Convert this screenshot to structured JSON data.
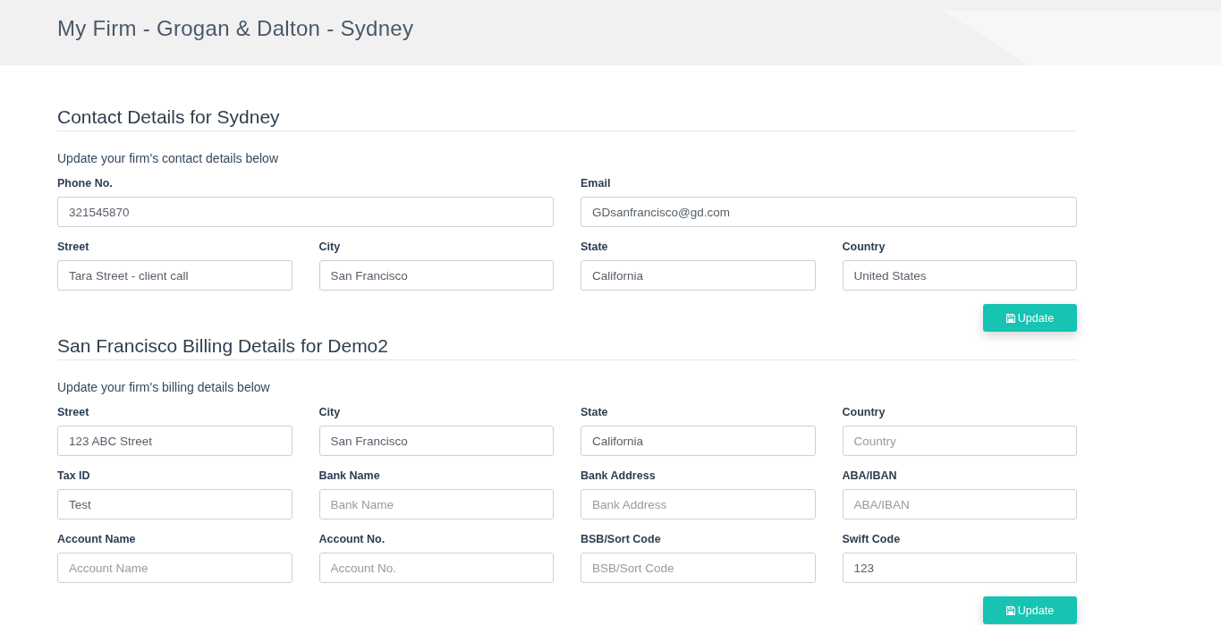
{
  "header": {
    "title": "My Firm - Grogan & Dalton - Sydney"
  },
  "sections": [
    {
      "heading": "Contact Details for Sydney",
      "subtitle": "Update your firm's contact details below",
      "fields": [
        {
          "kind": "wide",
          "label": "Phone No.",
          "value": "321545870"
        },
        {
          "kind": "wide",
          "label": "Email",
          "value": "GDsanfrancisco@gd.com"
        },
        {
          "kind": "normal",
          "label": "Street",
          "value": "Tara Street - client call"
        },
        {
          "kind": "normal",
          "label": "City",
          "value": "San Francisco"
        },
        {
          "kind": "normal",
          "label": "State",
          "value": "California"
        },
        {
          "kind": "normal",
          "label": "Country",
          "value": "United States"
        }
      ],
      "button": "Update"
    },
    {
      "heading": "San Francisco Billing Details for Demo2",
      "subtitle": "Update your firm's billing details below",
      "fields": [
        {
          "kind": "normal",
          "label": "Street",
          "value": "123 ABC Street"
        },
        {
          "kind": "normal",
          "label": "City",
          "value": "San Francisco"
        },
        {
          "kind": "normal",
          "label": "State",
          "value": "California"
        },
        {
          "kind": "normal",
          "label": "Country",
          "placeholder": "Country"
        },
        {
          "kind": "normal",
          "label": "Tax ID",
          "value": "Test"
        },
        {
          "kind": "normal",
          "label": "Bank Name",
          "placeholder": "Bank Name"
        },
        {
          "kind": "normal",
          "label": "Bank Address",
          "placeholder": "Bank Address"
        },
        {
          "kind": "normal",
          "label": "ABA/IBAN",
          "placeholder": "ABA/IBAN"
        },
        {
          "kind": "normal",
          "label": "Account Name",
          "placeholder": "Account Name"
        },
        {
          "kind": "normal",
          "label": "Account No.",
          "placeholder": "Account No."
        },
        {
          "kind": "normal",
          "label": "BSB/Sort Code",
          "placeholder": "BSB/Sort Code"
        },
        {
          "kind": "normal",
          "label": "Swift Code",
          "value": "123"
        }
      ],
      "button": "Update"
    }
  ]
}
